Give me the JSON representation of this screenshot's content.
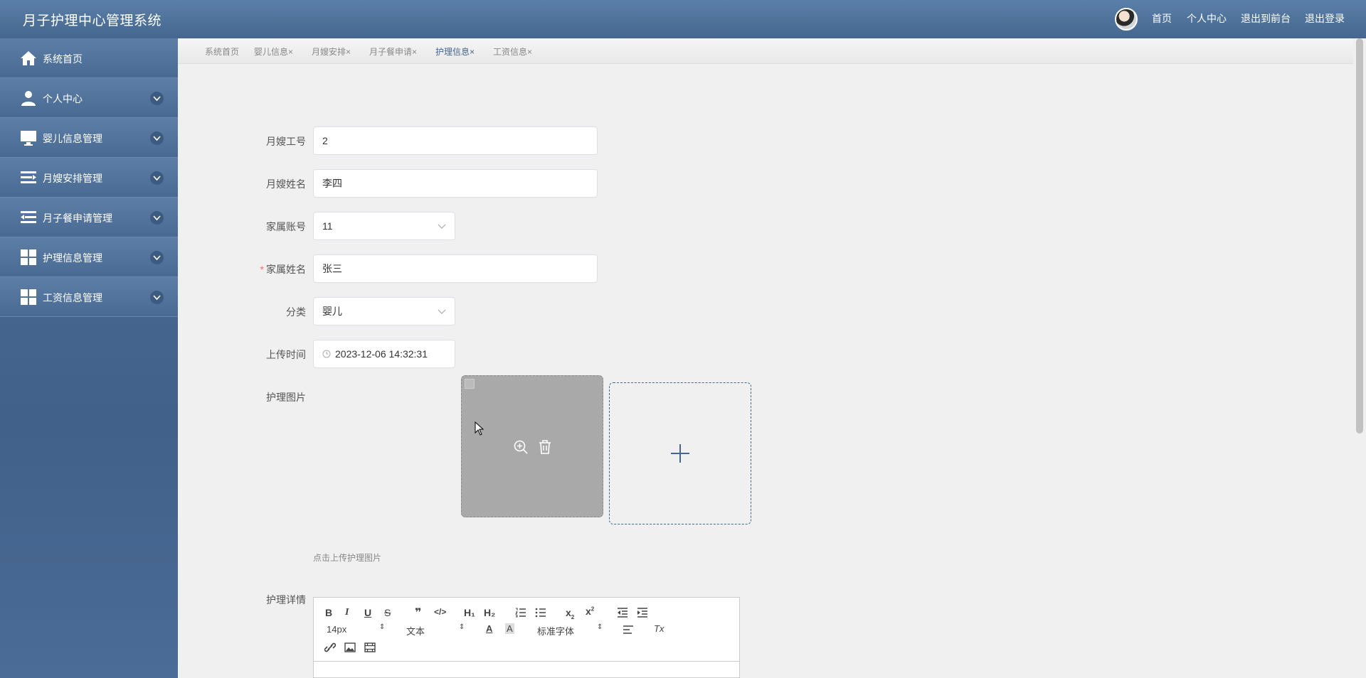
{
  "app": {
    "title": "月子护理中心管理系统"
  },
  "topnav": {
    "home": "首页",
    "profile": "个人中心",
    "front": "退出到前台",
    "logout": "退出登录"
  },
  "sidebar": {
    "items": [
      {
        "label": "系统首页",
        "icon": "home-icon"
      },
      {
        "label": "个人中心",
        "icon": "user-icon"
      },
      {
        "label": "婴儿信息管理",
        "icon": "monitor-icon"
      },
      {
        "label": "月嫂安排管理",
        "icon": "list-icon"
      },
      {
        "label": "月子餐申请管理",
        "icon": "menu-icon"
      },
      {
        "label": "护理信息管理",
        "icon": "grid-icon"
      },
      {
        "label": "工资信息管理",
        "icon": "grid-icon"
      }
    ]
  },
  "tabs": [
    {
      "label": "系统首页",
      "close": ""
    },
    {
      "label": "婴儿信息",
      "close": "×"
    },
    {
      "label": "月嫂安排",
      "close": "×"
    },
    {
      "label": "月子餐申请",
      "close": "×"
    },
    {
      "label": "护理信息",
      "close": "×"
    },
    {
      "label": "工资信息",
      "close": "×"
    }
  ],
  "form": {
    "worker_id_label": "月嫂工号",
    "worker_id": "2",
    "worker_name_label": "月嫂姓名",
    "worker_name": "李四",
    "family_account_label": "家属账号",
    "family_account": "11",
    "family_name_required": "*",
    "family_name_label": "家属姓名",
    "family_name": "张三",
    "category_label": "分类",
    "category": "婴儿",
    "upload_time_label": "上传时间",
    "upload_time": "2023-12-06 14:32:31",
    "image_label": "护理图片",
    "image_hint": "点击上传护理图片",
    "details_label": "护理详情"
  },
  "editor": {
    "font_size": "14px",
    "block": "文本",
    "font_family": "标准字体",
    "h1": "H₁",
    "h2": "H₂"
  },
  "colors": {
    "primary": "#45678f",
    "sidebar": "#4f7099",
    "required": "#f56c6c"
  }
}
